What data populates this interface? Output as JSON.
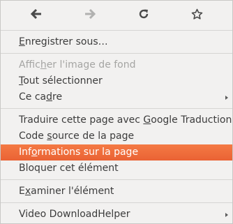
{
  "nav": {
    "back": {
      "icon": "arrow-left-icon"
    },
    "forward": {
      "icon": "arrow-right-icon",
      "disabled": true
    },
    "reload": {
      "icon": "reload-icon"
    },
    "bookmark": {
      "icon": "star-icon"
    }
  },
  "items": {
    "save_as": {
      "pre": "",
      "u": "E",
      "post": "nregistrer sous…"
    },
    "view_bg": {
      "pre": "Affic",
      "u": "h",
      "post": "er l'image de fond"
    },
    "select_all": {
      "pre": "",
      "u": "T",
      "post": "out sélectionner"
    },
    "this_frame": {
      "pre": "Ce ca",
      "u": "d",
      "post": "re"
    },
    "translate": {
      "pre": "Traduire cette page avec ",
      "u": "G",
      "post": "oogle Traduction"
    },
    "view_source": {
      "pre": "Code ",
      "u": "s",
      "post": "ource de la page"
    },
    "page_info": {
      "pre": "Inf",
      "u": "o",
      "post": "rmations sur la page"
    },
    "block_element": {
      "pre": "Bloquer cet élément",
      "u": "",
      "post": ""
    },
    "inspect": {
      "pre": "E",
      "u": "x",
      "post": "aminer l'élément"
    },
    "video_dl": {
      "pre": "Video DownloadHelper",
      "u": "",
      "post": ""
    }
  },
  "colors": {
    "highlight": "#ea6234",
    "disabled_text": "#a5a5a3",
    "menu_bg": "#f2f1f0"
  }
}
